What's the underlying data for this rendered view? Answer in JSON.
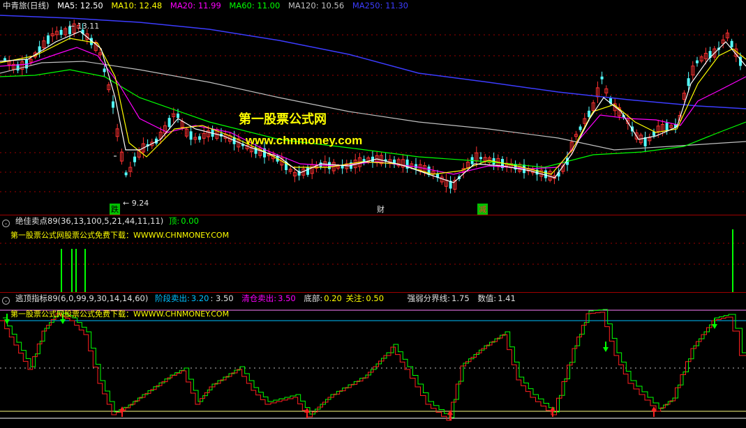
{
  "main": {
    "title": "中青旅(日线)",
    "ma": [
      {
        "label": "MA5: 12.50",
        "color": "#ffffff"
      },
      {
        "label": "MA10: 12.48",
        "color": "#ffff00"
      },
      {
        "label": "MA20: 11.99",
        "color": "#ff00ff"
      },
      {
        "label": "MA60: 11.00",
        "color": "#00ff00"
      },
      {
        "label": "MA120: 10.56",
        "color": "#c0c0c0"
      },
      {
        "label": "MA250: 11.30",
        "color": "#3c3cff"
      }
    ],
    "high_label": "13.11",
    "low_label": "9.24",
    "watermark_cn": "第一股票公式网",
    "watermark_url": "www.chnmoney.com",
    "markers": [
      {
        "text": "跌",
        "bg": "#00c000"
      },
      {
        "text": "财",
        "bg": "transparent"
      },
      {
        "text": "减",
        "bg": "#00c000"
      }
    ]
  },
  "sub1": {
    "title": "绝佳卖点89(36,13,100,5,21,44,11,11)",
    "ding_label": "顶:",
    "ding_value": "0.00",
    "notice": "第一股票公式网股票公式免费下载：WWWW.CHNMONEY.COM"
  },
  "sub2": {
    "title": "逃顶指标89(6,0,99,9,30,14,14,60)",
    "stage_label": "阶段卖出:",
    "stage_value": "3.20",
    "stage_value2": ": 3.50",
    "clear_label": "清仓卖出:",
    "clear_value": "3.50",
    "bottom_label": "底部:",
    "bottom_value": "0.20",
    "watch_label": "关注:",
    "watch_value": "0.50",
    "strong_label": "强弱分界线:",
    "strong_value": "1.75",
    "num_label": "数值:",
    "num_value": "1.41",
    "notice": "第一股票公式网股票公式免费下载：WWWW.CHNMONEY.COM"
  }
}
